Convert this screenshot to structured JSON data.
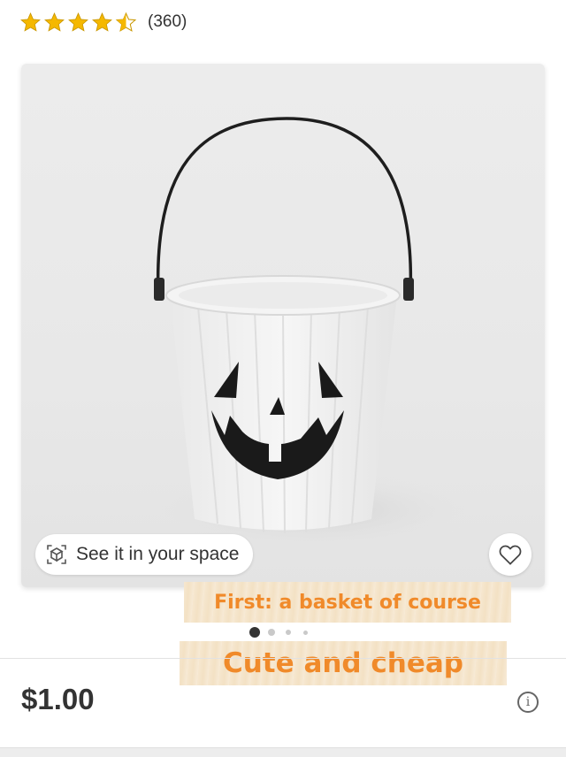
{
  "rating": {
    "value": 4.5,
    "out_of": 5,
    "count_text": "(360)",
    "star_color": "#f5b800"
  },
  "product_image": {
    "ar_button_label": "See it in your space",
    "ar_icon": "augmented-reality-cube-icon",
    "favorite_icon": "heart-outline-icon"
  },
  "overlay": {
    "caption_1": "First: a basket of course",
    "caption_2": "Cute and cheap",
    "caption_color": "#f08a2a"
  },
  "carousel": {
    "current_index": 1,
    "total_dots": 4
  },
  "price": {
    "text": "$1.00",
    "info_icon": "info-icon",
    "info_glyph": "i"
  }
}
